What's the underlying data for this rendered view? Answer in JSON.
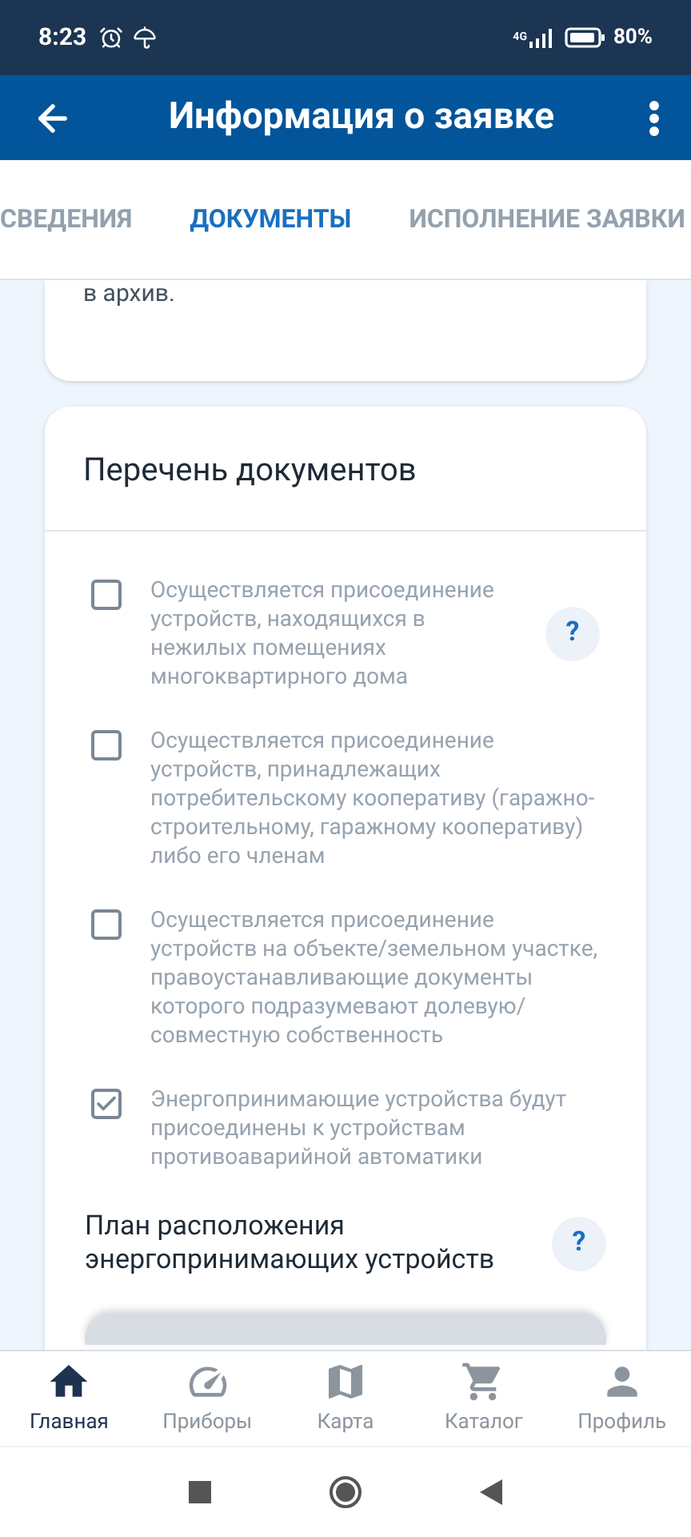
{
  "status_bar": {
    "time": "8:23",
    "network": "4G",
    "battery": "80%"
  },
  "app_bar": {
    "title": "Информация о заявке"
  },
  "tabs": [
    {
      "label": "СВЕДЕНИЯ",
      "selected": false
    },
    {
      "label": "ДОКУМЕНТЫ",
      "selected": true
    },
    {
      "label": "ИСПОЛНЕНИЕ ЗАЯВКИ",
      "selected": false
    }
  ],
  "previous_card": {
    "text_tail": "в архив."
  },
  "documents_card": {
    "title": "Перечень документов",
    "items": [
      {
        "label": "Осуществляется присоединение устройств, находящихся в нежилых помещениях многоквартирного дома",
        "checked": false,
        "help": "?"
      },
      {
        "label": "Осуществляется присоединение устройств, принадлежащих потребительскому кооперативу (гаражно-строительному, гаражному кооперативу) либо его членам",
        "checked": false
      },
      {
        "label": "Осуществляется присоединение устройств на объекте/земельном участке, правоустанавливающие документы которого подразумевают долевую/совместную собственность",
        "checked": false
      },
      {
        "label": "Энергопринимающие устройства будут присоединены к устройствам противоаварийной автоматики",
        "checked": true
      }
    ],
    "section": {
      "title": "План расположения энергопринимающих устройств",
      "help": "?"
    }
  },
  "bottom_nav": [
    {
      "label": "Главная",
      "selected": true
    },
    {
      "label": "Приборы",
      "selected": false
    },
    {
      "label": "Карта",
      "selected": false
    },
    {
      "label": "Каталог",
      "selected": false
    },
    {
      "label": "Профиль",
      "selected": false
    }
  ]
}
